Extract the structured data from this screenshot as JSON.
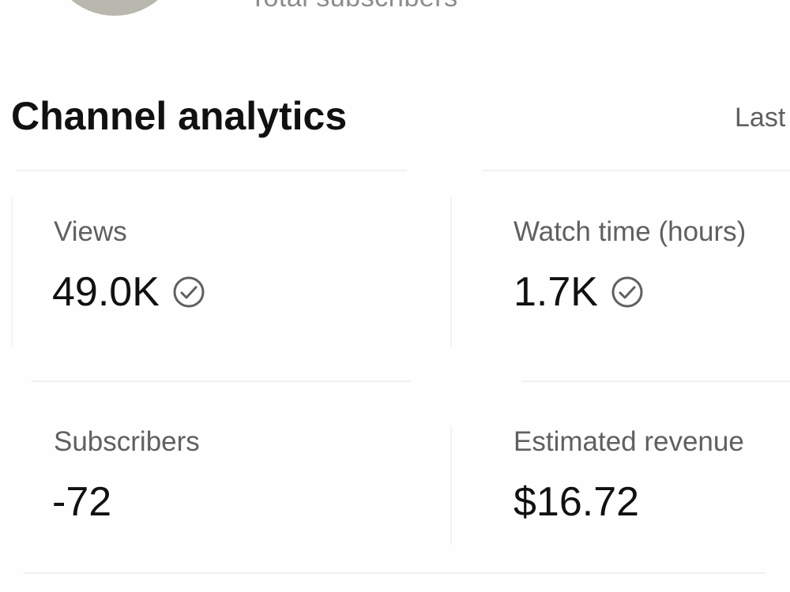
{
  "header": {
    "total_subscribers_label": "Total subscribers"
  },
  "analytics": {
    "title": "Channel analytics",
    "period_label": "Last",
    "metrics": [
      {
        "label": "Views",
        "value": "49.0K",
        "icon": "check-circle-icon"
      },
      {
        "label": "Watch time (hours)",
        "value": "1.7K",
        "icon": "check-circle-icon"
      },
      {
        "label": "Subscribers",
        "value": "-72"
      },
      {
        "label": "Estimated revenue",
        "value": "$16.72"
      }
    ]
  },
  "colors": {
    "text_primary": "#111111",
    "text_secondary": "#606060",
    "divider": "#f1f1f1"
  }
}
